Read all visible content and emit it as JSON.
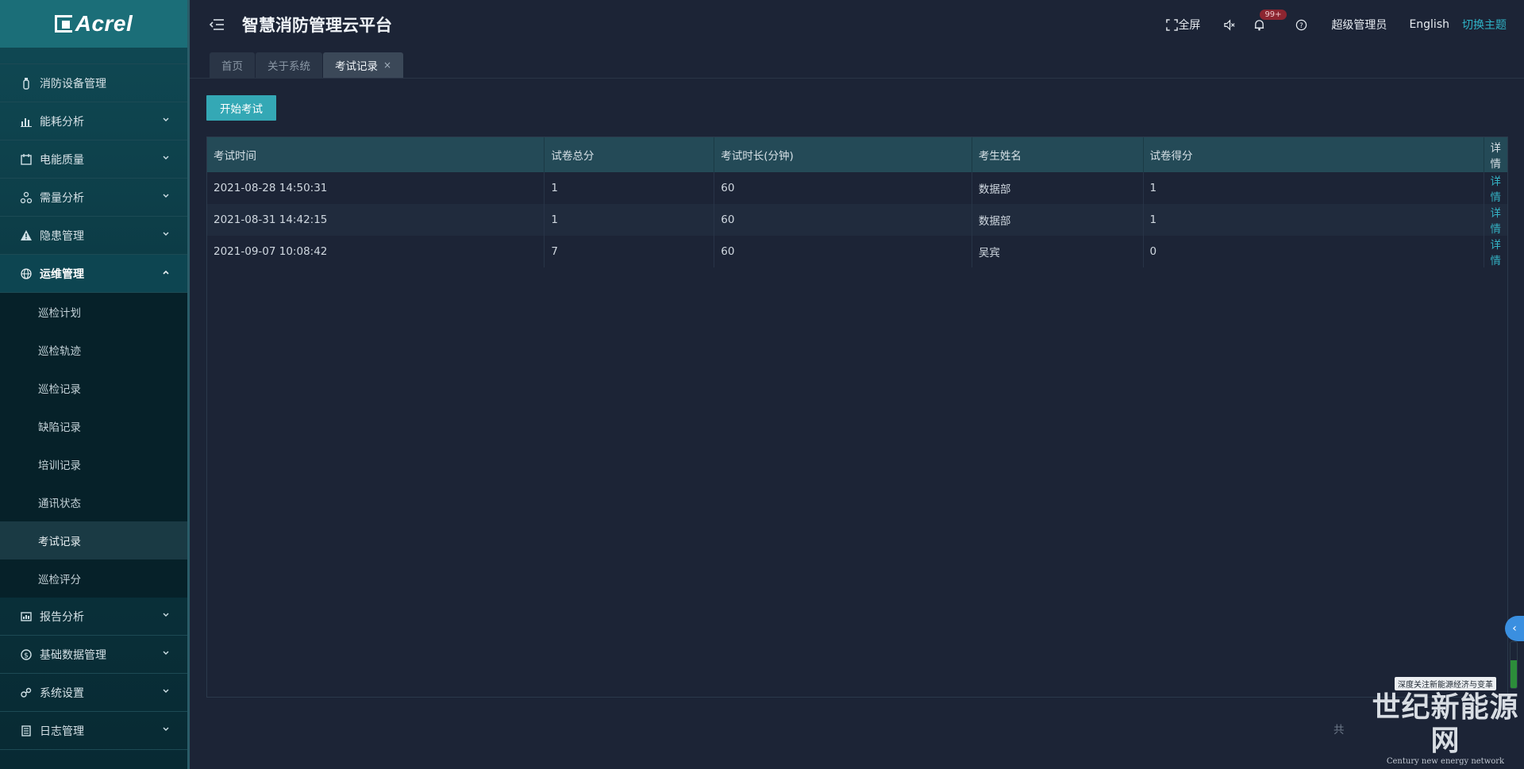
{
  "brand": {
    "logo_text": "Acrel"
  },
  "header": {
    "title": "智慧消防管理云平台",
    "fullscreen_label": "全屏",
    "notifications_count": "99+",
    "user_label": "超级管理员",
    "language_label": "English",
    "theme_label": "切换主题"
  },
  "sidebar": {
    "items_top": [
      {
        "label": "消防设备管理",
        "icon": "fire-extinguisher-icon"
      },
      {
        "label": "能耗分析",
        "icon": "bar-chart-icon"
      },
      {
        "label": "电能质量",
        "icon": "calendar-icon"
      },
      {
        "label": "需量分析",
        "icon": "nodes-icon"
      },
      {
        "label": "隐患管理",
        "icon": "warning-icon"
      },
      {
        "label": "运维管理",
        "icon": "globe-icon"
      }
    ],
    "submenu": [
      "巡检计划",
      "巡检轨迹",
      "巡检记录",
      "缺陷记录",
      "培训记录",
      "通讯状态",
      "考试记录",
      "巡检评分"
    ],
    "items_bottom": [
      {
        "label": "报告分析",
        "icon": "report-icon"
      },
      {
        "label": "基础数据管理",
        "icon": "database-icon"
      },
      {
        "label": "系统设置",
        "icon": "settings-icon"
      },
      {
        "label": "日志管理",
        "icon": "log-icon"
      }
    ]
  },
  "tabs": [
    {
      "label": "首页"
    },
    {
      "label": "关于系统"
    },
    {
      "label": "考试记录",
      "close": "×"
    }
  ],
  "content": {
    "start_button": "开始考试",
    "table": {
      "headers": [
        "考试时间",
        "试卷总分",
        "考试时长(分钟)",
        "考生姓名",
        "试卷得分",
        "详情"
      ],
      "rows": [
        [
          "2021-08-28 14:50:31",
          "1",
          "60",
          "数据部",
          "1",
          "详情"
        ],
        [
          "2021-08-31 14:42:15",
          "1",
          "60",
          "数据部",
          "1",
          "详情"
        ],
        [
          "2021-09-07 10:08:42",
          "7",
          "60",
          "吴宾",
          "0",
          "详情"
        ]
      ]
    },
    "pager_text": "共"
  },
  "watermark": {
    "tagline": "深度关注新能源经济与变革",
    "name": "世纪新能源网",
    "sub": "Century new energy network"
  },
  "colors": {
    "accent": "#34a8b5",
    "link": "#34b2c4",
    "badge": "#8c2530"
  }
}
